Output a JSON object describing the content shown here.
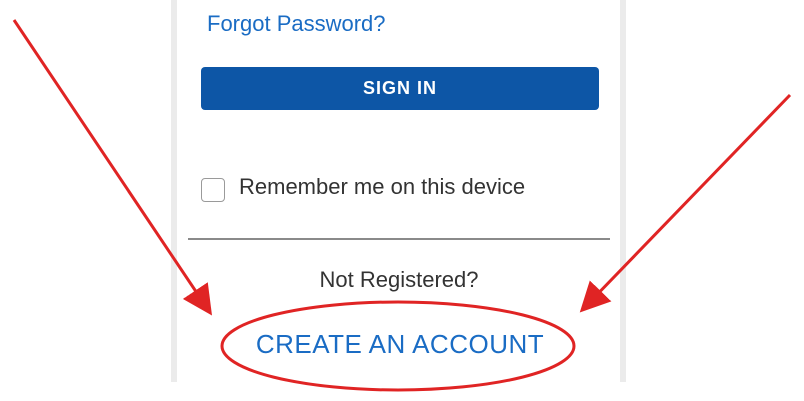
{
  "login_form": {
    "forgot_password_label": "Forgot Password?",
    "sign_in_label": "SIGN IN",
    "remember_me_label": "Remember me on this device",
    "remember_me_checked": false,
    "not_registered_text": "Not Registered?",
    "create_account_label": "CREATE AN ACCOUNT"
  },
  "colors": {
    "link": "#1a6cc4",
    "primary_button": "#0d56a6",
    "annotation": "#e02424",
    "text": "#333333"
  },
  "annotations": {
    "arrows": [
      "arrow-pointing-to-create-account",
      "arrow-pointing-to-create-account"
    ],
    "highlight": "ellipse-around-create-account"
  }
}
